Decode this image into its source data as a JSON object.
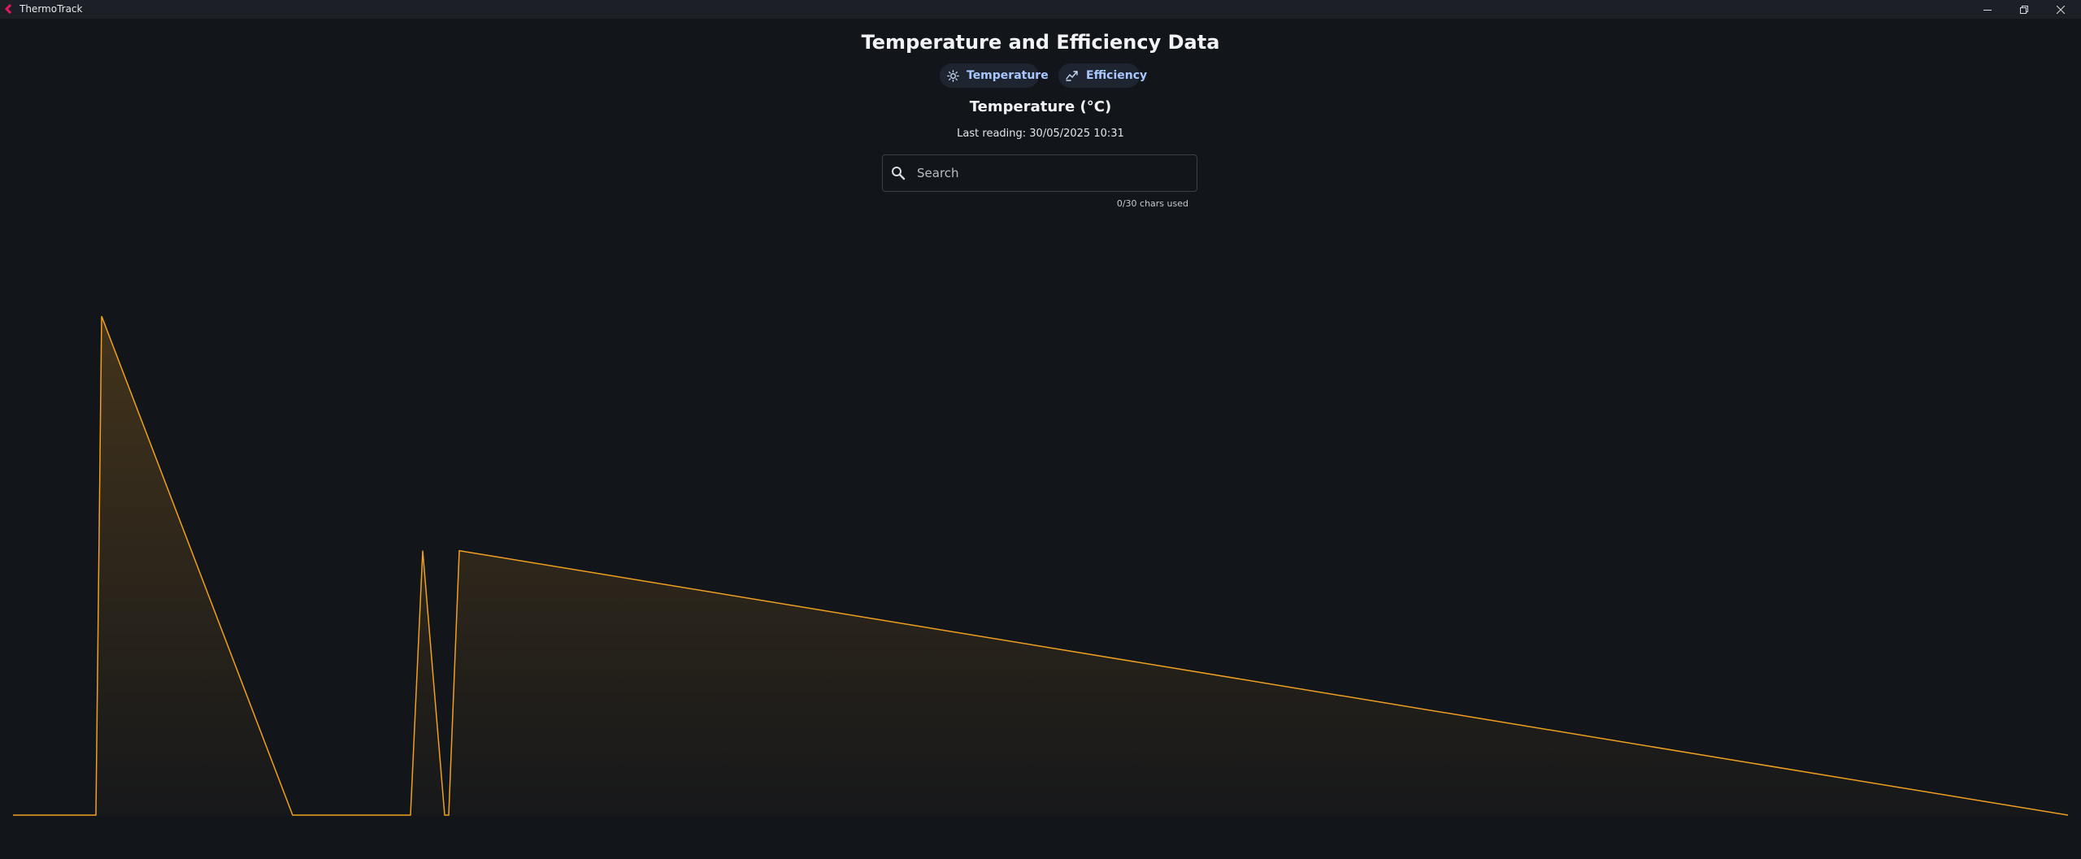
{
  "window": {
    "title": "ThermoTrack",
    "accent_color": "#e8185f"
  },
  "page": {
    "heading": "Temperature and Efficiency Data",
    "tabs": [
      {
        "label": "Temperature",
        "icon": "sun-icon",
        "selected": true
      },
      {
        "label": "Efficiency",
        "icon": "trend-icon",
        "selected": false
      }
    ],
    "subheading": "Temperature (°C)",
    "last_reading": "Last reading: 30/05/2025 10:31",
    "search": {
      "placeholder": "Search",
      "value": "",
      "char_count": "0/30 chars used"
    }
  },
  "chart_data": {
    "type": "area",
    "line_color": "#f0a020",
    "grid": false,
    "legend": "none",
    "ylim": [
      0,
      100
    ],
    "x": [
      0,
      1,
      2,
      3,
      4,
      5,
      6,
      7,
      8,
      9,
      10
    ],
    "values": [
      0,
      0,
      100,
      0,
      0,
      53,
      0,
      0,
      53,
      0,
      0
    ]
  }
}
